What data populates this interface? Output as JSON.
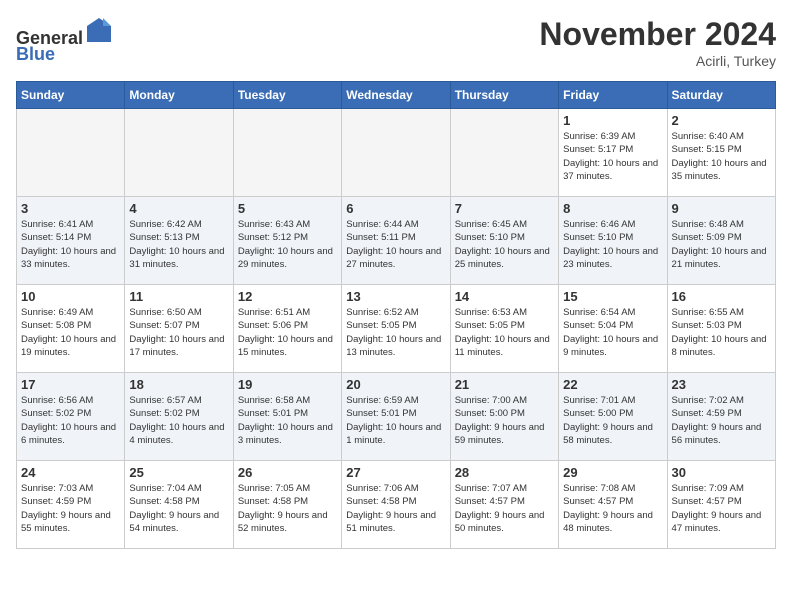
{
  "header": {
    "logo_general": "General",
    "logo_blue": "Blue",
    "month_title": "November 2024",
    "location": "Acirli, Turkey"
  },
  "days_of_week": [
    "Sunday",
    "Monday",
    "Tuesday",
    "Wednesday",
    "Thursday",
    "Friday",
    "Saturday"
  ],
  "weeks": [
    [
      {
        "day": "",
        "empty": true
      },
      {
        "day": "",
        "empty": true
      },
      {
        "day": "",
        "empty": true
      },
      {
        "day": "",
        "empty": true
      },
      {
        "day": "",
        "empty": true
      },
      {
        "day": "1",
        "sunrise": "6:39 AM",
        "sunset": "5:17 PM",
        "daylight": "10 hours and 37 minutes."
      },
      {
        "day": "2",
        "sunrise": "6:40 AM",
        "sunset": "5:15 PM",
        "daylight": "10 hours and 35 minutes."
      }
    ],
    [
      {
        "day": "3",
        "sunrise": "6:41 AM",
        "sunset": "5:14 PM",
        "daylight": "10 hours and 33 minutes."
      },
      {
        "day": "4",
        "sunrise": "6:42 AM",
        "sunset": "5:13 PM",
        "daylight": "10 hours and 31 minutes."
      },
      {
        "day": "5",
        "sunrise": "6:43 AM",
        "sunset": "5:12 PM",
        "daylight": "10 hours and 29 minutes."
      },
      {
        "day": "6",
        "sunrise": "6:44 AM",
        "sunset": "5:11 PM",
        "daylight": "10 hours and 27 minutes."
      },
      {
        "day": "7",
        "sunrise": "6:45 AM",
        "sunset": "5:10 PM",
        "daylight": "10 hours and 25 minutes."
      },
      {
        "day": "8",
        "sunrise": "6:46 AM",
        "sunset": "5:10 PM",
        "daylight": "10 hours and 23 minutes."
      },
      {
        "day": "9",
        "sunrise": "6:48 AM",
        "sunset": "5:09 PM",
        "daylight": "10 hours and 21 minutes."
      }
    ],
    [
      {
        "day": "10",
        "sunrise": "6:49 AM",
        "sunset": "5:08 PM",
        "daylight": "10 hours and 19 minutes."
      },
      {
        "day": "11",
        "sunrise": "6:50 AM",
        "sunset": "5:07 PM",
        "daylight": "10 hours and 17 minutes."
      },
      {
        "day": "12",
        "sunrise": "6:51 AM",
        "sunset": "5:06 PM",
        "daylight": "10 hours and 15 minutes."
      },
      {
        "day": "13",
        "sunrise": "6:52 AM",
        "sunset": "5:05 PM",
        "daylight": "10 hours and 13 minutes."
      },
      {
        "day": "14",
        "sunrise": "6:53 AM",
        "sunset": "5:05 PM",
        "daylight": "10 hours and 11 minutes."
      },
      {
        "day": "15",
        "sunrise": "6:54 AM",
        "sunset": "5:04 PM",
        "daylight": "10 hours and 9 minutes."
      },
      {
        "day": "16",
        "sunrise": "6:55 AM",
        "sunset": "5:03 PM",
        "daylight": "10 hours and 8 minutes."
      }
    ],
    [
      {
        "day": "17",
        "sunrise": "6:56 AM",
        "sunset": "5:02 PM",
        "daylight": "10 hours and 6 minutes."
      },
      {
        "day": "18",
        "sunrise": "6:57 AM",
        "sunset": "5:02 PM",
        "daylight": "10 hours and 4 minutes."
      },
      {
        "day": "19",
        "sunrise": "6:58 AM",
        "sunset": "5:01 PM",
        "daylight": "10 hours and 3 minutes."
      },
      {
        "day": "20",
        "sunrise": "6:59 AM",
        "sunset": "5:01 PM",
        "daylight": "10 hours and 1 minute."
      },
      {
        "day": "21",
        "sunrise": "7:00 AM",
        "sunset": "5:00 PM",
        "daylight": "9 hours and 59 minutes."
      },
      {
        "day": "22",
        "sunrise": "7:01 AM",
        "sunset": "5:00 PM",
        "daylight": "9 hours and 58 minutes."
      },
      {
        "day": "23",
        "sunrise": "7:02 AM",
        "sunset": "4:59 PM",
        "daylight": "9 hours and 56 minutes."
      }
    ],
    [
      {
        "day": "24",
        "sunrise": "7:03 AM",
        "sunset": "4:59 PM",
        "daylight": "9 hours and 55 minutes."
      },
      {
        "day": "25",
        "sunrise": "7:04 AM",
        "sunset": "4:58 PM",
        "daylight": "9 hours and 54 minutes."
      },
      {
        "day": "26",
        "sunrise": "7:05 AM",
        "sunset": "4:58 PM",
        "daylight": "9 hours and 52 minutes."
      },
      {
        "day": "27",
        "sunrise": "7:06 AM",
        "sunset": "4:58 PM",
        "daylight": "9 hours and 51 minutes."
      },
      {
        "day": "28",
        "sunrise": "7:07 AM",
        "sunset": "4:57 PM",
        "daylight": "9 hours and 50 minutes."
      },
      {
        "day": "29",
        "sunrise": "7:08 AM",
        "sunset": "4:57 PM",
        "daylight": "9 hours and 48 minutes."
      },
      {
        "day": "30",
        "sunrise": "7:09 AM",
        "sunset": "4:57 PM",
        "daylight": "9 hours and 47 minutes."
      }
    ]
  ]
}
